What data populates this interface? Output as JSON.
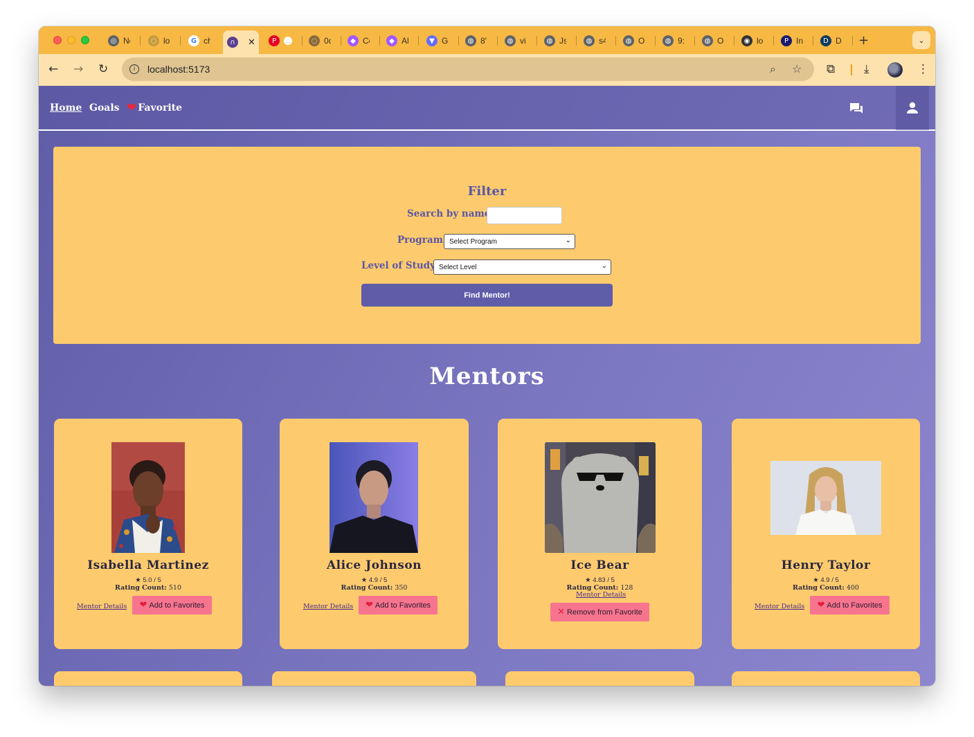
{
  "browser": {
    "tabs": [
      {
        "label": "Ne",
        "icon": "chrome-icon",
        "color": "#5f6368"
      },
      {
        "label": "lo",
        "icon": "loader-icon",
        "color": "#c79b3c"
      },
      {
        "label": "ch",
        "icon": "google-icon",
        "color": "#4285f4"
      },
      {
        "label": "",
        "icon": "arc-icon",
        "color": "#5a3e8f",
        "active": true
      },
      {
        "label": "",
        "icon": "pinterest-icon",
        "color": "#e60023"
      },
      {
        "label": "0c",
        "icon": "loader-icon",
        "color": "#8a6a3a"
      },
      {
        "label": "Cc",
        "icon": "figma-icon",
        "color": "#a259ff"
      },
      {
        "label": "Al",
        "icon": "figma-icon",
        "color": "#a259ff"
      },
      {
        "label": "G",
        "icon": "vite-icon",
        "color": "#646cff"
      },
      {
        "label": "8'",
        "icon": "globe-icon",
        "color": "#5f6368"
      },
      {
        "label": "vi",
        "icon": "globe-icon",
        "color": "#5f6368"
      },
      {
        "label": "Js",
        "icon": "globe-icon",
        "color": "#5f6368"
      },
      {
        "label": "s4",
        "icon": "globe-icon",
        "color": "#5f6368"
      },
      {
        "label": "O",
        "icon": "globe-icon",
        "color": "#5f6368"
      },
      {
        "label": "9:",
        "icon": "globe-icon",
        "color": "#5f6368"
      },
      {
        "label": "O",
        "icon": "globe-icon",
        "color": "#5f6368"
      },
      {
        "label": "lo",
        "icon": "target-icon",
        "color": "#333333"
      },
      {
        "label": "In",
        "icon": "p-logo-icon",
        "color": "#1a1a6e"
      },
      {
        "label": "D",
        "icon": "d-logo-icon",
        "color": "#0e3b5e"
      }
    ],
    "url": "localhost:5173"
  },
  "nav": {
    "home": "Home",
    "goals": "Goals",
    "favorite": "Favorite"
  },
  "filter": {
    "title": "Filter",
    "search_label": "Search by name:",
    "search_value": "",
    "program_label": "Program:",
    "program_selected": "Select Program",
    "level_label": "Level of Study:",
    "level_selected": "Select Level",
    "find_button": "Find Mentor!"
  },
  "mentors_title": "Mentors",
  "mentors": [
    {
      "name": "Isabella Martinez",
      "rating": "5.0 / 5",
      "count_label": "Rating Count:",
      "count": "510",
      "details": "Mentor Details",
      "action": "Add to Favorites",
      "favorited": false
    },
    {
      "name": "Alice Johnson",
      "rating": "4.9 / 5",
      "count_label": "Rating Count:",
      "count": "350",
      "details": "Mentor Details",
      "action": "Add to Favorites",
      "favorited": false
    },
    {
      "name": "Ice Bear",
      "rating": "4.83 / 5",
      "count_label": "Rating Count:",
      "count": "128",
      "details": "Mentor Details",
      "action": "Remove from Favorite",
      "favorited": true
    },
    {
      "name": "Henry Taylor",
      "rating": "4.9 / 5",
      "count_label": "Rating Count:",
      "count": "400",
      "details": "Mentor Details",
      "action": "Add to Favorites",
      "favorited": false
    }
  ],
  "colors": {
    "page_purple": "#6d68b4",
    "card_yellow": "#fdcb6e",
    "accent_purple": "#5f5ca8",
    "fav_pink": "#f7748f",
    "browser_orange": "#f7b844"
  }
}
